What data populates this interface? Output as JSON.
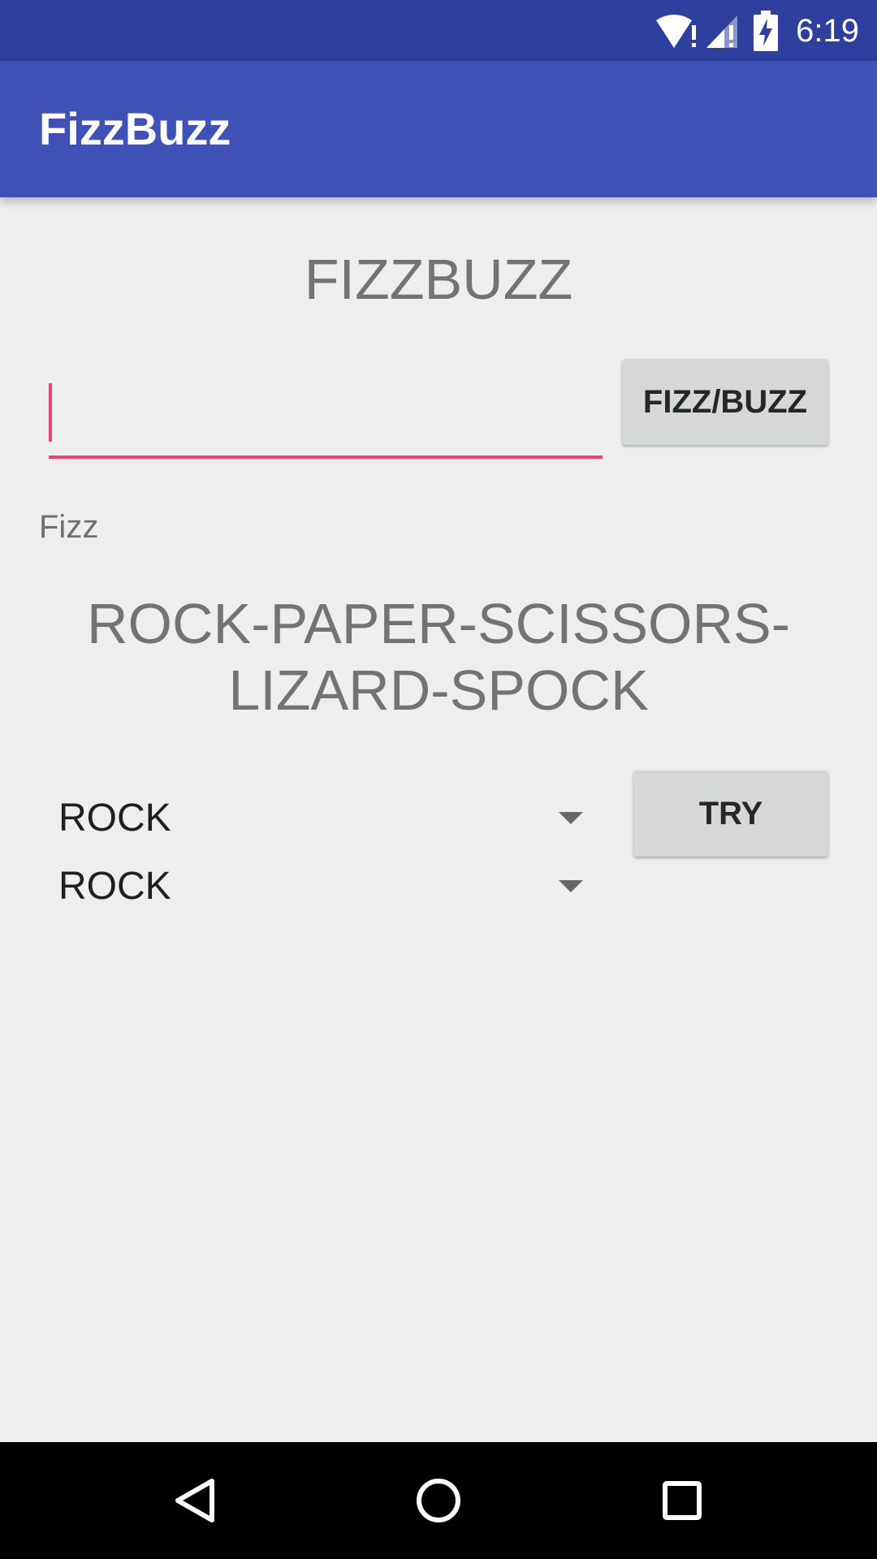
{
  "status_bar": {
    "time": "6:19",
    "icons": [
      "wifi-alert-icon",
      "cell-signal-alert-icon",
      "battery-charging-icon"
    ]
  },
  "app_bar": {
    "title": "FizzBuzz"
  },
  "fizzbuzz": {
    "heading": "FIZZBUZZ",
    "input_value": "",
    "button_label": "FIZZ/BUZZ",
    "result": "Fizz"
  },
  "rps": {
    "heading_line1": "ROCK-PAPER-SCISSORS-",
    "heading_line2": "LIZARD-SPOCK",
    "choice1": "ROCK",
    "choice2": "ROCK",
    "try_label": "TRY"
  },
  "nav_bar": {
    "icons": [
      "back-icon",
      "home-icon",
      "recents-icon"
    ]
  },
  "colors": {
    "status_bar": "#2f3f9e",
    "app_bar": "#3f51b5",
    "accent": "#e7457a",
    "background": "#eeeeee",
    "button": "#d6d7d7"
  }
}
